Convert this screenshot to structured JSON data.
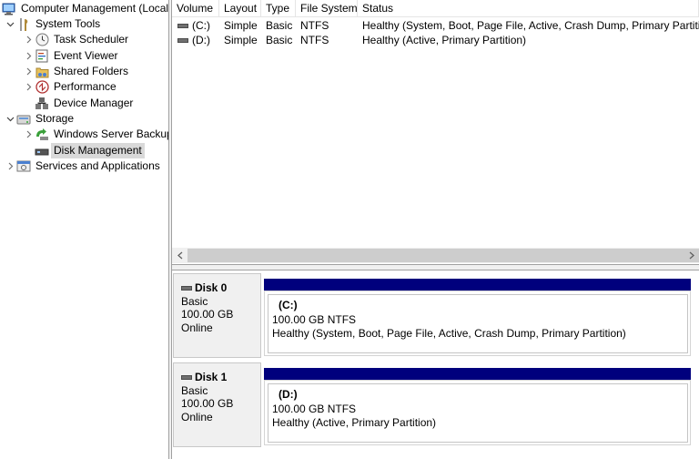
{
  "tree": {
    "root": "Computer Management (Local",
    "items": [
      {
        "label": "System Tools",
        "icon": "tools-icon",
        "expander": "expanded"
      },
      {
        "label": "Task Scheduler",
        "icon": "clock-icon",
        "expander": "collapsed"
      },
      {
        "label": "Event Viewer",
        "icon": "event-viewer-icon",
        "expander": "collapsed"
      },
      {
        "label": "Shared Folders",
        "icon": "shared-folder-icon",
        "expander": "collapsed"
      },
      {
        "label": "Performance",
        "icon": "performance-icon",
        "expander": "collapsed"
      },
      {
        "label": "Device Manager",
        "icon": "device-manager-icon",
        "expander": "none"
      },
      {
        "label": "Storage",
        "icon": "storage-icon",
        "expander": "expanded"
      },
      {
        "label": "Windows Server Backup",
        "icon": "backup-icon",
        "expander": "collapsed"
      },
      {
        "label": "Disk Management",
        "icon": "disk-icon",
        "expander": "none"
      },
      {
        "label": "Services and Applications",
        "icon": "services-icon",
        "expander": "collapsed"
      }
    ],
    "selected": "Disk Management"
  },
  "volume_list": {
    "columns": [
      "Volume",
      "Layout",
      "Type",
      "File System",
      "Status"
    ],
    "rows": [
      {
        "volume": "(C:)",
        "layout": "Simple",
        "type": "Basic",
        "fs": "NTFS",
        "status": "Healthy (System, Boot, Page File, Active, Crash Dump, Primary Partition)"
      },
      {
        "volume": "(D:)",
        "layout": "Simple",
        "type": "Basic",
        "fs": "NTFS",
        "status": "Healthy (Active, Primary Partition)"
      }
    ]
  },
  "disks": [
    {
      "name": "Disk 0",
      "type": "Basic",
      "size": "100.00 GB",
      "state": "Online",
      "partition": {
        "name": "(C:)",
        "size_fs": "100.00 GB NTFS",
        "status": "Healthy (System, Boot, Page File, Active, Crash Dump, Primary Partition)"
      }
    },
    {
      "name": "Disk 1",
      "type": "Basic",
      "size": "100.00 GB",
      "state": "Online",
      "partition": {
        "name": "(D:)",
        "size_fs": "100.00 GB NTFS",
        "status": "Healthy (Active, Primary Partition)"
      }
    }
  ],
  "colors": {
    "partition_bar": "#00007d",
    "selection": "#d9d9d9",
    "panel_bg": "#f0f0f0"
  }
}
